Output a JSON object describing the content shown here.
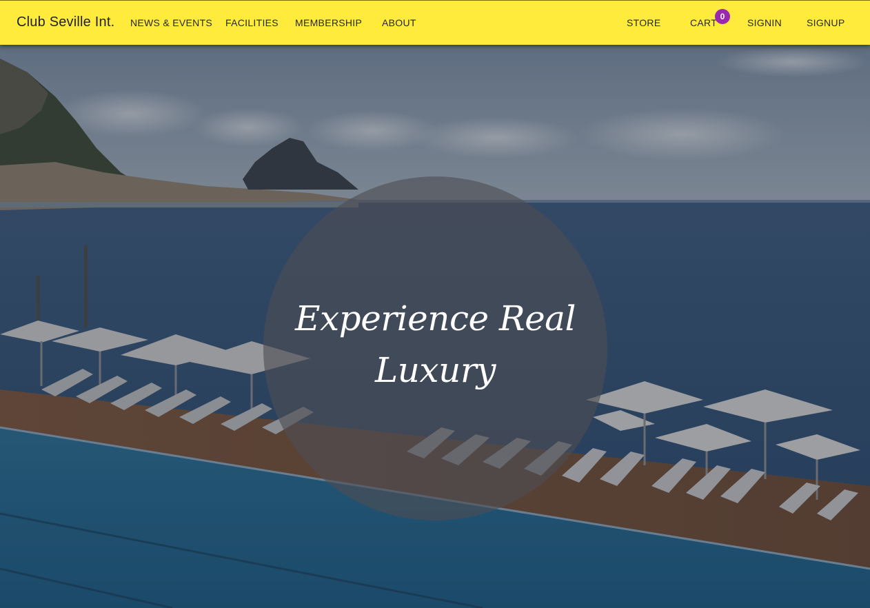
{
  "header": {
    "brand": "Club Seville Int.",
    "nav_left": [
      "NEWS & EVENTS",
      "FACILITIES",
      "MEMBERSHIP",
      "ABOUT"
    ],
    "nav_right": [
      "STORE",
      "CART",
      "SIGNIN",
      "SIGNUP"
    ],
    "cart_count": "0",
    "background_color": "#ffeb3b",
    "badge_color": "#9c27b0"
  },
  "hero": {
    "headline_line1": "Experience Real",
    "headline_line2": "Luxury",
    "scene": "seaside-pool-resort-photo"
  }
}
